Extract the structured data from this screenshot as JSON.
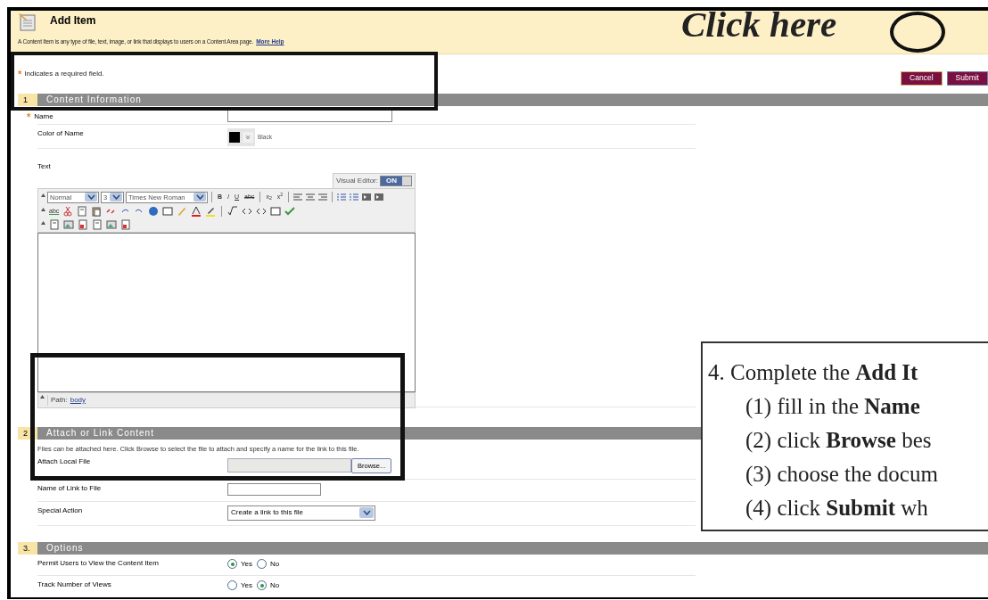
{
  "page": {
    "title": "Add Item",
    "description": "A Content Item is any type of file, text, image, or link that displays to users on a Content Area page.",
    "help_link": "More Help"
  },
  "required_note": {
    "mark": "*",
    "text": "Indicates a required field."
  },
  "buttons": [
    {
      "label": "Cancel"
    },
    {
      "label": "Submit"
    }
  ],
  "sections": [
    {
      "number": "1",
      "title": "Content Information"
    },
    {
      "number": "2",
      "title": "Attach or Link Content",
      "description": "Files can be attached here. Click Browse to select the file to attach and specify a name for the link to this file."
    },
    {
      "number": "3.",
      "title": "Options"
    }
  ],
  "content_fields": {
    "name": {
      "label": "Name",
      "required": true
    },
    "color": {
      "label": "Color of Name",
      "color": "#000000",
      "value": "Black"
    },
    "text": {
      "label": "Text"
    }
  },
  "editor": {
    "toggle_label": "Visual Editor:",
    "toggle_text": "ON",
    "on": true,
    "selects": [
      {
        "value": "Normal"
      },
      {
        "value": "3"
      },
      {
        "value": "Times New Roman"
      }
    ],
    "format_buttons": [
      "B",
      "I",
      "U",
      "abc"
    ],
    "script_buttons": [
      "x$_{2}$",
      "x$^{2}$"
    ],
    "spell_button": "abc",
    "path_label": "Path:",
    "path_link": "body"
  },
  "attach_fields": {
    "file": {
      "label": "Attach Local File",
      "button": "Browse..."
    },
    "link_name": {
      "label": "Name of Link to File"
    },
    "action": {
      "label": "Special Action",
      "value": "Create a link to this file"
    }
  },
  "options": [
    {
      "label": "Permit Users to View the Content Item",
      "choices": [
        {
          "label": "Yes",
          "selected": true
        },
        {
          "label": "No",
          "selected": false
        }
      ]
    },
    {
      "label": "Track Number of Views",
      "choices": [
        {
          "label": "Yes",
          "selected": false
        },
        {
          "label": "No",
          "selected": true
        }
      ]
    }
  ],
  "annotation": {
    "click_text": "Click here",
    "steps": [
      "4. Complete the **Add It**",
      "(1) fill in the **Name**",
      "(2) click **Browse** bes",
      "(3) choose the docum",
      "(4) click **Submit** wh"
    ]
  }
}
